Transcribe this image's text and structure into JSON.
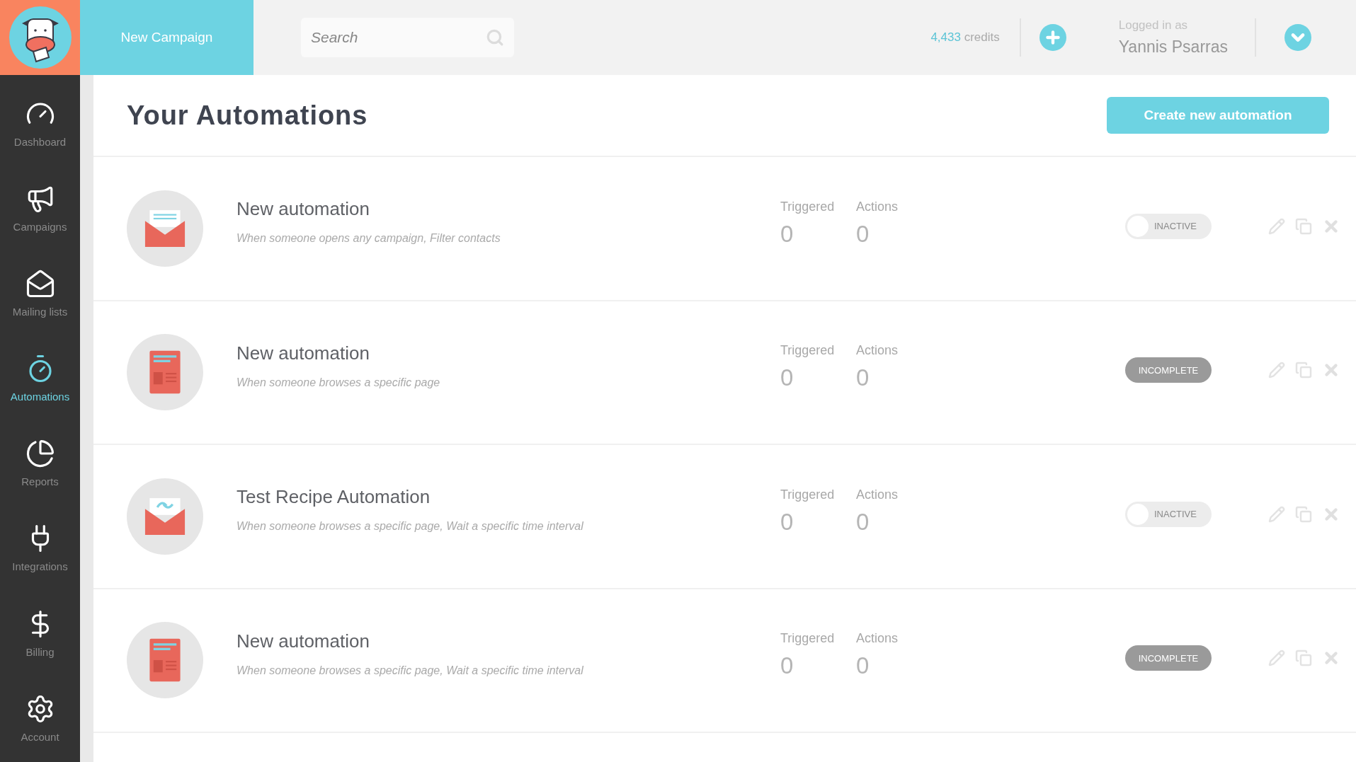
{
  "header": {
    "new_campaign": "New Campaign",
    "search": {
      "placeholder": "Search"
    },
    "credits_amount": "4,433",
    "credits_label": "credits",
    "logged_in_label": "Logged in as",
    "user_name": "Yannis Psarras"
  },
  "sidebar": {
    "items": [
      {
        "label": "Dashboard",
        "selected": false
      },
      {
        "label": "Campaigns",
        "selected": false
      },
      {
        "label": "Mailing lists",
        "selected": false
      },
      {
        "label": "Automations",
        "selected": true
      },
      {
        "label": "Reports",
        "selected": false
      },
      {
        "label": "Integrations",
        "selected": false
      },
      {
        "label": "Billing",
        "selected": false
      },
      {
        "label": "Account",
        "selected": false
      }
    ]
  },
  "page": {
    "title": "Your Automations",
    "create_button": "Create new automation"
  },
  "automations": [
    {
      "name": "New automation",
      "description": "When someone opens any campaign, Filter contacts",
      "kind": "envelope",
      "triggered_label": "Triggered",
      "triggered": "0",
      "actions_label": "Actions",
      "actions": "0",
      "status": {
        "kind": "toggle",
        "on": false,
        "label": "INACTIVE"
      }
    },
    {
      "name": "New automation",
      "description": "When someone browses a specific page",
      "kind": "page",
      "triggered_label": "Triggered",
      "triggered": "0",
      "actions_label": "Actions",
      "actions": "0",
      "status": {
        "kind": "badge",
        "label": "INCOMPLETE"
      }
    },
    {
      "name": "Test Recipe Automation",
      "description": "When someone browses a specific page, Wait a specific time interval",
      "kind": "link-envelope",
      "triggered_label": "Triggered",
      "triggered": "0",
      "actions_label": "Actions",
      "actions": "0",
      "status": {
        "kind": "toggle",
        "on": false,
        "label": "INACTIVE"
      }
    },
    {
      "name": "New automation",
      "description": "When someone browses a specific page, Wait a specific time interval",
      "kind": "page",
      "triggered_label": "Triggered",
      "triggered": "0",
      "actions_label": "Actions",
      "actions": "0",
      "status": {
        "kind": "badge",
        "label": "INCOMPLETE"
      }
    }
  ]
}
